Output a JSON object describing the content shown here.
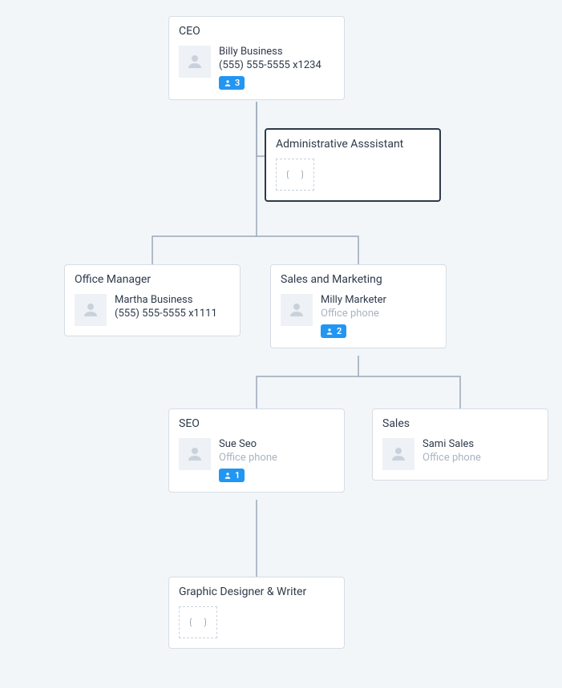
{
  "nodes": {
    "ceo": {
      "title": "CEO",
      "name": "Billy Business",
      "phone": "(555) 555-5555 x1234",
      "badge": "3"
    },
    "admin": {
      "title": "Administrative Asssistant"
    },
    "office_manager": {
      "title": "Office Manager",
      "name": "Martha Business",
      "phone": "(555) 555-5555 x1111"
    },
    "sales_marketing": {
      "title": "Sales and Marketing",
      "name": "Milly Marketer",
      "phone": "Office phone",
      "badge": "2"
    },
    "seo": {
      "title": "SEO",
      "name": "Sue Seo",
      "phone": "Office phone",
      "badge": "1"
    },
    "sales": {
      "title": "Sales",
      "name": "Sami Sales",
      "phone": "Office phone"
    },
    "graphic": {
      "title": "Graphic Designer & Writer"
    }
  },
  "colors": {
    "badge_bg": "#2196f3",
    "border": "#d5dde5",
    "bg": "#f3f6f9"
  }
}
